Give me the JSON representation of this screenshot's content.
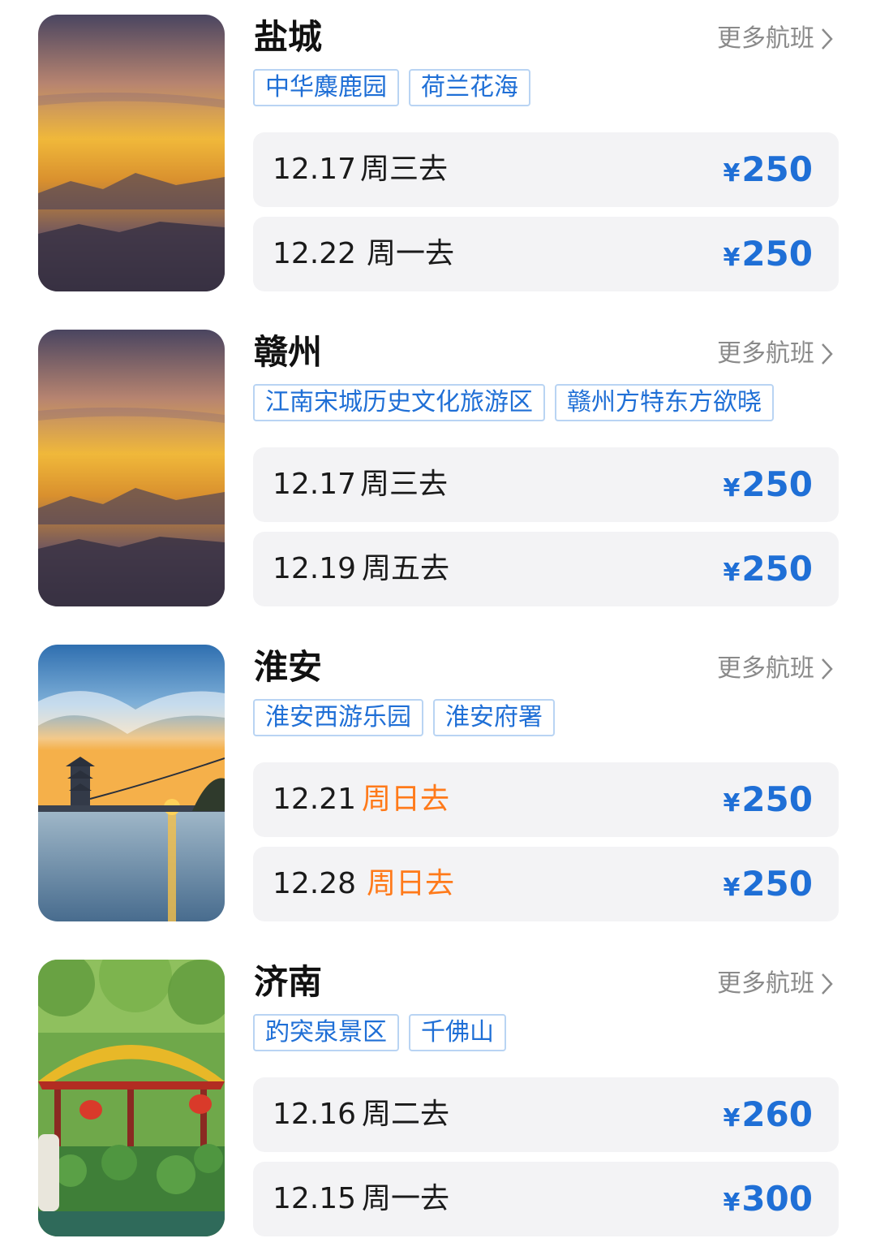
{
  "colors": {
    "accent_blue": "#1f6fd6",
    "weekend_orange": "#ff7a1a",
    "row_bg": "#f3f3f5",
    "tag_border": "#b9d4f3",
    "muted_text": "#8a8a8a"
  },
  "cards": [
    {
      "city": "盐城",
      "more_label": "更多航班",
      "image": "mountain-sunset-photo",
      "tags": [
        "中华麋鹿园",
        "荷兰花海"
      ],
      "flights": [
        {
          "date": "12.17",
          "weekday": "周三去",
          "weekend": false,
          "currency": "¥",
          "price": "250"
        },
        {
          "date": "12.22",
          "weekday": "周一去",
          "weekend": false,
          "currency": "¥",
          "price": "250"
        }
      ]
    },
    {
      "city": "赣州",
      "more_label": "更多航班",
      "image": "mountain-sunset-photo",
      "tags": [
        "江南宋城历史文化旅游区",
        "赣州方特东方欲晓"
      ],
      "flights": [
        {
          "date": "12.17",
          "weekday": "周三去",
          "weekend": false,
          "currency": "¥",
          "price": "250"
        },
        {
          "date": "12.19",
          "weekday": "周五去",
          "weekend": false,
          "currency": "¥",
          "price": "250"
        }
      ]
    },
    {
      "city": "淮安",
      "more_label": "更多航班",
      "image": "lake-pagoda-sunset-photo",
      "tags": [
        "淮安西游乐园",
        "淮安府署"
      ],
      "flights": [
        {
          "date": "12.21",
          "weekday": "周日去",
          "weekend": true,
          "currency": "¥",
          "price": "250"
        },
        {
          "date": "12.28",
          "weekday": "周日去",
          "weekend": true,
          "currency": "¥",
          "price": "250"
        }
      ]
    },
    {
      "city": "济南",
      "more_label": "更多航班",
      "image": "pavilion-garden-photo",
      "tags": [
        "趵突泉景区",
        "千佛山"
      ],
      "flights": [
        {
          "date": "12.16",
          "weekday": "周二去",
          "weekend": false,
          "currency": "¥",
          "price": "260"
        },
        {
          "date": "12.15",
          "weekday": "周一去",
          "weekend": false,
          "currency": "¥",
          "price": "300"
        }
      ]
    }
  ]
}
